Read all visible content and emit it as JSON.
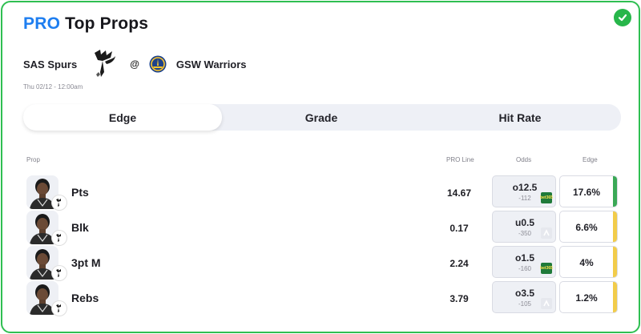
{
  "title": {
    "pro": "PRO",
    "rest": "Top Props"
  },
  "matchup": {
    "away_team": "SAS Spurs",
    "at": "@",
    "home_team": "GSW Warriors",
    "datetime": "Thu 02/12 - 12:00am"
  },
  "tabs": [
    {
      "label": "Edge",
      "active": true
    },
    {
      "label": "Grade",
      "active": false
    },
    {
      "label": "Hit Rate",
      "active": false
    }
  ],
  "columns": {
    "prop": "Prop",
    "pro_line": "PRO Line",
    "odds": "Odds",
    "edge": "Edge"
  },
  "rows": [
    {
      "prop": "Pts",
      "pro_line": "14.67",
      "odds_line": "o12.5",
      "odds_price": "-112",
      "book": "bet365",
      "edge": "17.6%",
      "edge_color": "#3aa856"
    },
    {
      "prop": "Blk",
      "pro_line": "0.17",
      "odds_line": "u0.5",
      "odds_price": "-350",
      "book": "alt",
      "edge": "6.6%",
      "edge_color": "#f2cc4a"
    },
    {
      "prop": "3pt M",
      "pro_line": "2.24",
      "odds_line": "o1.5",
      "odds_price": "-160",
      "book": "bet365",
      "edge": "4%",
      "edge_color": "#f2cc4a"
    },
    {
      "prop": "Rebs",
      "pro_line": "3.79",
      "odds_line": "o3.5",
      "odds_price": "-105",
      "book": "alt",
      "edge": "1.2%",
      "edge_color": "#f2cc4a"
    }
  ],
  "book_labels": {
    "bet365_line1": "bet",
    "bet365_line2": "365"
  },
  "colors": {
    "brand": "#1e7ef0",
    "border": "#2fbf52",
    "edge_strong": "#3aa856",
    "edge_mid": "#f2cc4a"
  }
}
